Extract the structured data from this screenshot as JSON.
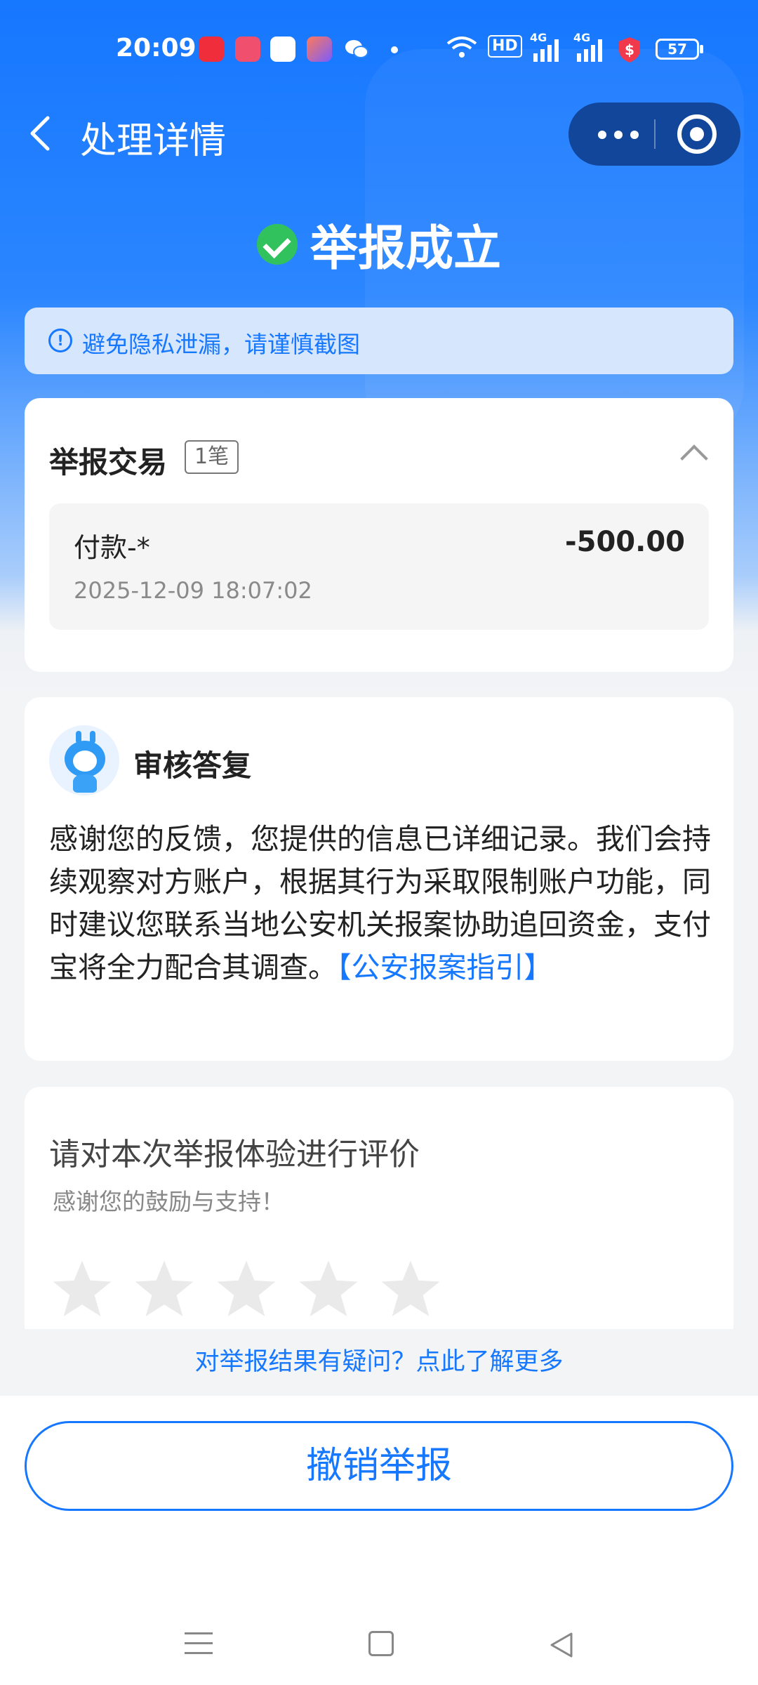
{
  "status_bar": {
    "time": "20:09",
    "network": "HD",
    "signal1": "4G",
    "signal2": "4G",
    "battery": "57"
  },
  "nav": {
    "title": "处理详情"
  },
  "headline": "举报成立",
  "notice": "避免隐私泄漏，请谨慎截图",
  "transactions": {
    "title": "举报交易",
    "count_tag": "1笔",
    "items": [
      {
        "name": "付款-*",
        "amount": "-500.00",
        "time": "2025-12-09 18:07:02"
      }
    ]
  },
  "reply": {
    "title": "审核答复",
    "text": "感谢您的反馈，您提供的信息已详细记录。我们会持续观察对方账户，根据其行为采取限制账户功能，同时建议您联系当地公安机关报案协助追回资金，支付宝将全力配合其调查。",
    "link": "【公安报案指引】"
  },
  "rating": {
    "title": "请对本次举报体验进行评价",
    "subtitle": "感谢您的鼓励与支持！",
    "stars_total": 5,
    "stars_selected": 0
  },
  "query_link": "对举报结果有疑问？点此了解更多",
  "revoke_button": "撤销举报",
  "colors": {
    "primary": "#1677ff",
    "success": "#31c25e"
  }
}
